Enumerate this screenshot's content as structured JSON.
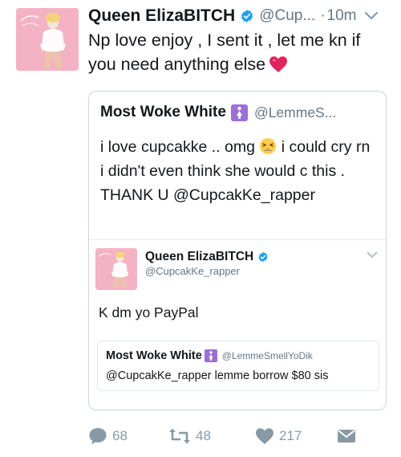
{
  "tweet": {
    "author_name": "Queen ElizaBITCH",
    "handle": "@Cup...",
    "time_separator": "·",
    "time": "10m",
    "text": "Np love enjoy , I sent it , let me kn if you need anything else"
  },
  "quote": {
    "author_name": "Most Woke White",
    "handle": "@LemmeS...",
    "text_part1": "i love cupcakke .. omg ",
    "text_part2": " i could cry rn i didn't even think she would c this . THANK U @CupcakKe_rapper"
  },
  "inner_tweet": {
    "author_name": "Queen ElizaBITCH",
    "handle": "@CupcakKe_rapper",
    "text": "K dm yo PayPal"
  },
  "nested_quote": {
    "author_name": "Most Woke White",
    "handle": "@LemmeSmellYoDik",
    "text": "@CupcakKe_rapper lemme borrow $80 sis"
  },
  "actions": {
    "replies": "68",
    "retweets": "48",
    "likes": "217"
  },
  "colors": {
    "text": "#14171a",
    "secondary": "#657786",
    "icon": "#8899a6",
    "verified": "#1da1f2",
    "border": "#ccd6dd",
    "heart": "#e0245e"
  },
  "icons": [
    "verified-badge-icon",
    "chevron-down-icon",
    "heart-emoji-icon",
    "tired-face-emoji-icon",
    "woman-emoji-icon",
    "reply-icon",
    "retweet-icon",
    "like-icon",
    "direct-message-icon"
  ]
}
